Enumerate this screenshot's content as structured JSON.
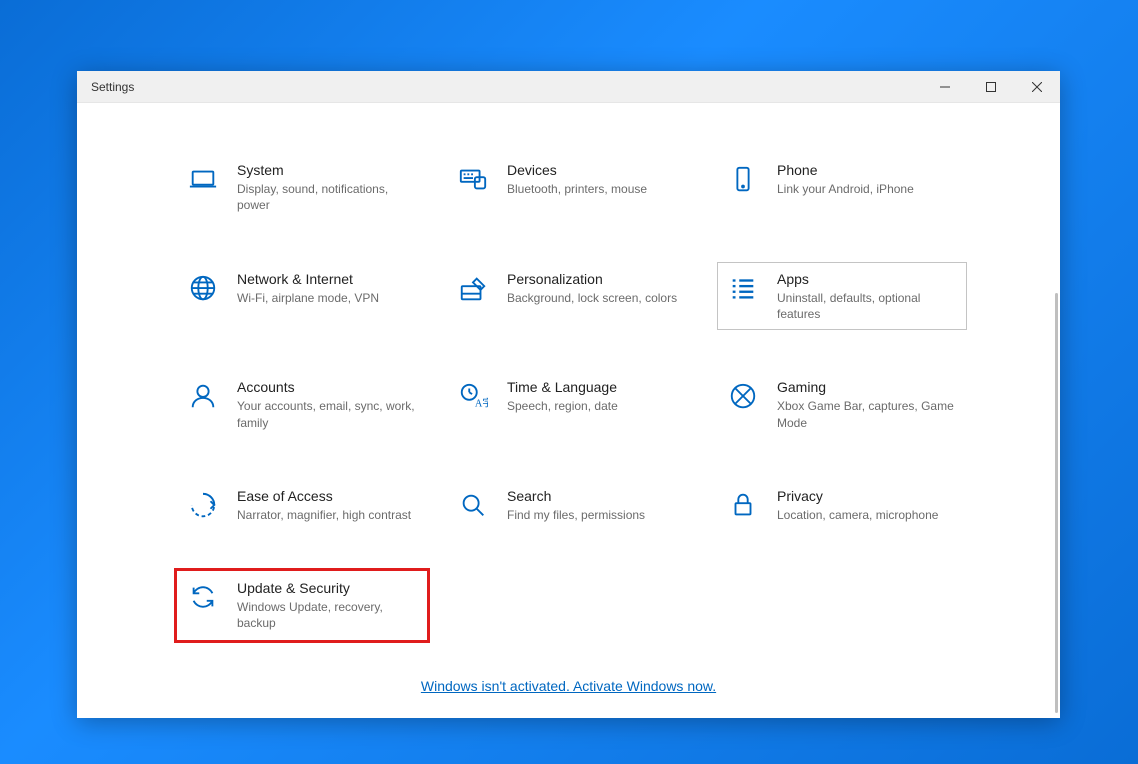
{
  "window": {
    "title": "Settings"
  },
  "activation": {
    "link_text": "Windows isn't activated. Activate Windows now."
  },
  "tiles": [
    {
      "key": "system",
      "title": "System",
      "desc": "Display, sound, notifications, power",
      "icon": "laptop-icon",
      "highlight": false,
      "hover": false
    },
    {
      "key": "devices",
      "title": "Devices",
      "desc": "Bluetooth, printers, mouse",
      "icon": "keyboard-icon",
      "highlight": false,
      "hover": false
    },
    {
      "key": "phone",
      "title": "Phone",
      "desc": "Link your Android, iPhone",
      "icon": "phone-icon",
      "highlight": false,
      "hover": false
    },
    {
      "key": "network",
      "title": "Network & Internet",
      "desc": "Wi-Fi, airplane mode, VPN",
      "icon": "globe-icon",
      "highlight": false,
      "hover": false
    },
    {
      "key": "personalization",
      "title": "Personalization",
      "desc": "Background, lock screen, colors",
      "icon": "pen-icon",
      "highlight": false,
      "hover": false
    },
    {
      "key": "apps",
      "title": "Apps",
      "desc": "Uninstall, defaults, optional features",
      "icon": "list-icon",
      "highlight": false,
      "hover": true
    },
    {
      "key": "accounts",
      "title": "Accounts",
      "desc": "Your accounts, email, sync, work, family",
      "icon": "person-icon",
      "highlight": false,
      "hover": false
    },
    {
      "key": "time",
      "title": "Time & Language",
      "desc": "Speech, region, date",
      "icon": "time-lang-icon",
      "highlight": false,
      "hover": false
    },
    {
      "key": "gaming",
      "title": "Gaming",
      "desc": "Xbox Game Bar, captures, Game Mode",
      "icon": "xbox-icon",
      "highlight": false,
      "hover": false
    },
    {
      "key": "ease",
      "title": "Ease of Access",
      "desc": "Narrator, magnifier, high contrast",
      "icon": "ease-icon",
      "highlight": false,
      "hover": false
    },
    {
      "key": "search",
      "title": "Search",
      "desc": "Find my files, permissions",
      "icon": "search-icon",
      "highlight": false,
      "hover": false
    },
    {
      "key": "privacy",
      "title": "Privacy",
      "desc": "Location, camera, microphone",
      "icon": "lock-icon",
      "highlight": false,
      "hover": false
    },
    {
      "key": "update",
      "title": "Update & Security",
      "desc": "Windows Update, recovery, backup",
      "icon": "update-icon",
      "highlight": true,
      "hover": false
    }
  ]
}
